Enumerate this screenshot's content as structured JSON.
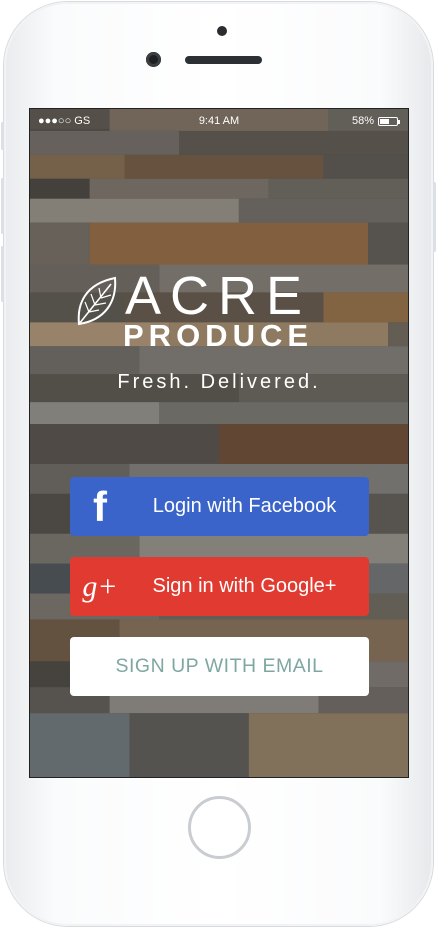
{
  "status_bar": {
    "carrier": "●●●○○ GS",
    "time": "9:41 AM",
    "battery": "58%",
    "battery_level": 0.58
  },
  "brand": {
    "name_main": "ACRE",
    "name_sub": "PRODUCE",
    "tagline": "Fresh. Delivered."
  },
  "buttons": {
    "facebook": {
      "label": "Login with Facebook",
      "icon": "f"
    },
    "google": {
      "label": "Sign in with Google+",
      "icon": "g+"
    },
    "email": {
      "label": "SIGN UP WITH EMAIL"
    }
  },
  "colors": {
    "facebook": "#3a64c9",
    "google": "#e13b31",
    "email_text": "#7ea7a2"
  }
}
